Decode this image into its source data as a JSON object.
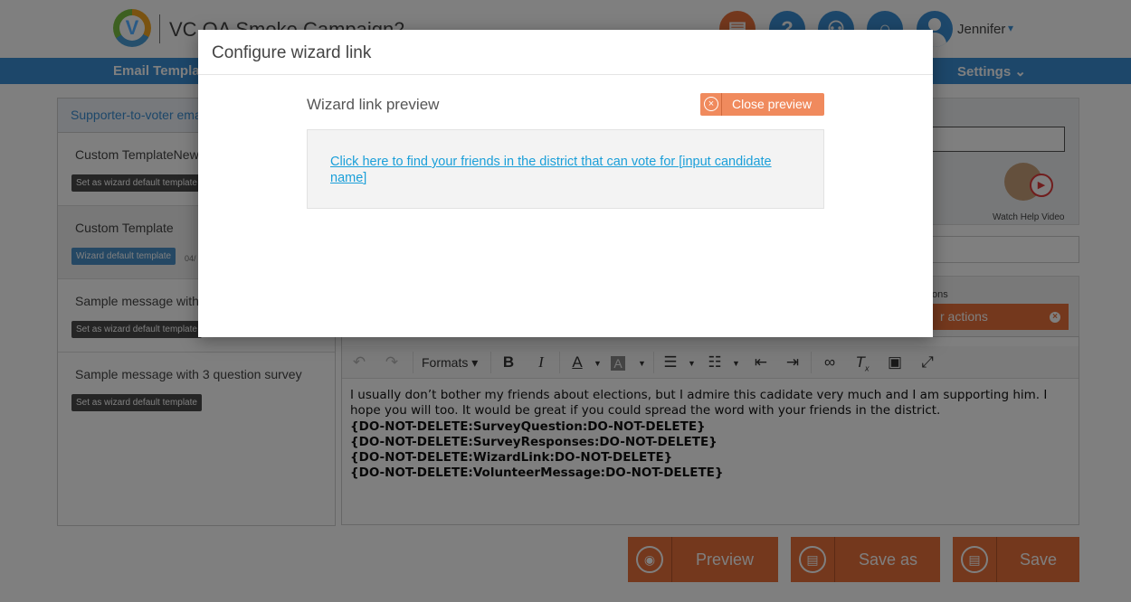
{
  "header": {
    "app_title": "VC QA Smoke Campaign2",
    "logo_letter": "V",
    "icons": [
      "document-icon",
      "help-icon",
      "users-icon",
      "search-icon"
    ],
    "user_name": "Jennifer",
    "user_caret": "▾"
  },
  "nav": {
    "items": [
      "Email Templates",
      "Settings ⌄"
    ]
  },
  "sidebar": {
    "title": "Supporter-to-voter emails",
    "items": [
      {
        "name": "Custom TemplateNew",
        "button": "Set as wizard default template",
        "date": ""
      },
      {
        "name": "Custom Template",
        "button": "Wizard default template",
        "date": "04/"
      },
      {
        "name": "Sample message with",
        "button": "Set as wizard default template",
        "date": ""
      },
      {
        "name": "Sample message with 3 question survey",
        "button": "Set as wizard default template",
        "date": ""
      }
    ]
  },
  "help": {
    "label": "Watch Help Video"
  },
  "actions": {
    "label": "ons",
    "chip": "r actions"
  },
  "toolbar": {
    "formats_label": "Formats",
    "bold": "B",
    "italic": "I",
    "font_color": "A",
    "bg_color": "A",
    "clear_format": "T",
    "clear_format_sub": "x"
  },
  "editor": {
    "line1": "I usually don’t bother my friends about elections, but I admire this cadidate very much and I am supporting him. I hope you will too. It would be great if you could spread the word with your friends in the district.",
    "tokens": [
      "{DO-NOT-DELETE:SurveyQuestion:DO-NOT-DELETE}",
      "{DO-NOT-DELETE:SurveyResponses:DO-NOT-DELETE}",
      "{DO-NOT-DELETE:WizardLink:DO-NOT-DELETE}",
      "{DO-NOT-DELETE:VolunteerMessage:DO-NOT-DELETE}"
    ]
  },
  "buttons": {
    "preview": "Preview",
    "save_as": "Save as",
    "save": "Save"
  },
  "modal": {
    "title": "Configure wizard link",
    "preview_label": "Wizard link preview",
    "close_preview": "Close preview",
    "link_text": "Click here to find your friends in the district that can vote for [input candidate name]"
  },
  "colors": {
    "accent_orange": "#e8703a",
    "accent_blue": "#3b8fd4",
    "link_blue": "#1a9fd9"
  }
}
